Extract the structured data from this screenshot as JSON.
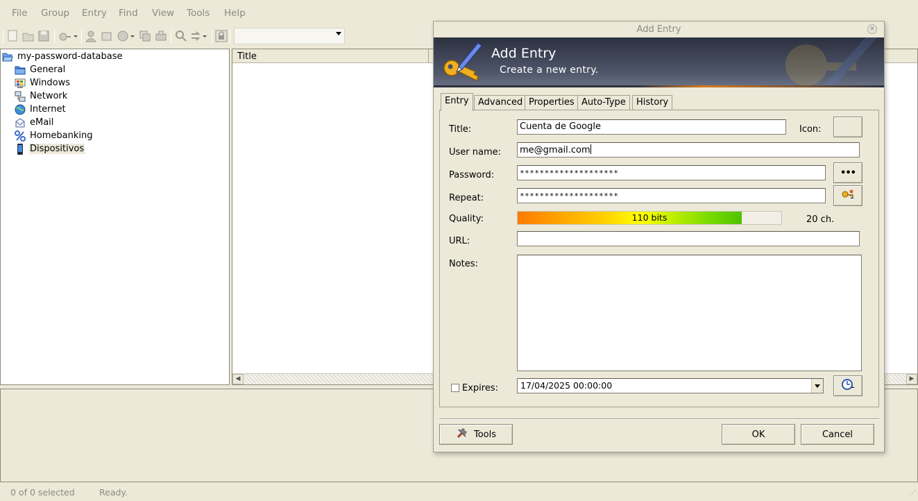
{
  "menubar": {
    "items": [
      "File",
      "Group",
      "Entry",
      "Find",
      "View",
      "Tools",
      "Help"
    ]
  },
  "tree": {
    "root": "my-password-database",
    "groups": [
      {
        "label": "General",
        "icon": "folder-icon"
      },
      {
        "label": "Windows",
        "icon": "windows-icon"
      },
      {
        "label": "Network",
        "icon": "network-icon"
      },
      {
        "label": "Internet",
        "icon": "globe-icon"
      },
      {
        "label": "eMail",
        "icon": "email-icon"
      },
      {
        "label": "Homebanking",
        "icon": "percent-icon"
      },
      {
        "label": "Dispositivos",
        "icon": "phone-icon"
      }
    ]
  },
  "entrylist": {
    "column_title": "Title"
  },
  "statusbar": {
    "selection": "0 of 0 selected",
    "state": "Ready."
  },
  "dialog": {
    "window_title": "Add Entry",
    "banner_title": "Add Entry",
    "banner_subtitle": "Create a new entry.",
    "tabs": [
      "Entry",
      "Advanced",
      "Properties",
      "Auto-Type",
      "History"
    ],
    "active_tab": "Entry",
    "labels": {
      "title": "Title:",
      "icon": "Icon:",
      "username": "User name:",
      "password": "Password:",
      "repeat": "Repeat:",
      "quality": "Quality:",
      "url": "URL:",
      "notes": "Notes:",
      "expires": "Expires:"
    },
    "values": {
      "title": "Cuenta de Google",
      "username": "me@gmail.com",
      "password": "********************",
      "repeat": "********************",
      "url": "",
      "notes": "",
      "expiry": "17/04/2025 00:00:00",
      "expires_checked": false
    },
    "quality": {
      "text": "110 bits",
      "length_text": "20 ch.",
      "fraction": 0.85
    },
    "buttons": {
      "tools": "Tools",
      "ok": "OK",
      "cancel": "Cancel",
      "show_password": "•••"
    },
    "colors": {
      "banner": "#3a4050",
      "accent": "#d77a20"
    }
  }
}
